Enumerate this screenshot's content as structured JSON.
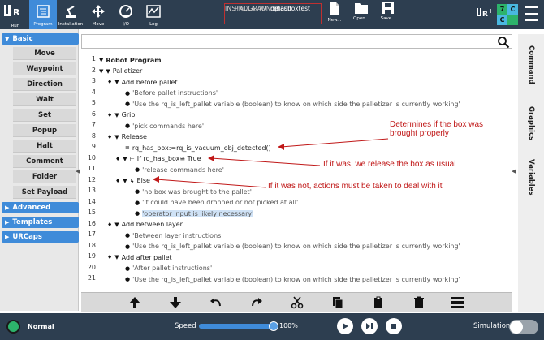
{
  "topbar": {
    "nav": [
      {
        "label": "Run"
      },
      {
        "label": "Program"
      },
      {
        "label": "Installation"
      },
      {
        "label": "Move"
      },
      {
        "label": "I/O"
      },
      {
        "label": "Log"
      }
    ],
    "program_key": "PROGRAM",
    "program_value": "rqhasboxtest",
    "installation_key": "INSTALLATION",
    "installation_value": "default",
    "file_buttons": [
      {
        "label": "New..."
      },
      {
        "label": "Open..."
      },
      {
        "label": "Save..."
      }
    ],
    "badges": [
      "7",
      "C",
      "C",
      ""
    ]
  },
  "sidebar": {
    "basic": "Basic",
    "items": [
      "Move",
      "Waypoint",
      "Direction",
      "Wait",
      "Set",
      "Popup",
      "Halt",
      "Comment",
      "Folder",
      "Set Payload"
    ],
    "advanced": "Advanced",
    "templates": "Templates",
    "urcaps": "URCaps"
  },
  "program": {
    "lines": [
      {
        "n": "1",
        "text": "Robot Program"
      },
      {
        "n": "2",
        "text": "Palletizer"
      },
      {
        "n": "3",
        "text": "Add before pallet"
      },
      {
        "n": "4",
        "text": "'Before pallet instructions'"
      },
      {
        "n": "5",
        "text": "'Use the rq_is_left_pallet variable (boolean) to know on which side the palletizer is currently working'"
      },
      {
        "n": "6",
        "text": "Grip"
      },
      {
        "n": "7",
        "text": "'pick commands here'"
      },
      {
        "n": "8",
        "text": "Release"
      },
      {
        "n": "9",
        "text": "rq_has_box:=rq_is_vacuum_obj_detected()"
      },
      {
        "n": "10",
        "text": "If rq_has_box≅ True"
      },
      {
        "n": "11",
        "text": "'release commands here'"
      },
      {
        "n": "12",
        "text": "Else"
      },
      {
        "n": "13",
        "text": "'no box was brought to the pallet'"
      },
      {
        "n": "14",
        "text": "'It could have been dropped or not picked at all'"
      },
      {
        "n": "15",
        "text": "'operator input is likely necessary'"
      },
      {
        "n": "16",
        "text": "Add between layer"
      },
      {
        "n": "17",
        "text": "'Between layer instructions'"
      },
      {
        "n": "18",
        "text": "'Use the rq_is_left_pallet variable (boolean) to know on which side the palletizer is currently working'"
      },
      {
        "n": "19",
        "text": "Add after pallet"
      },
      {
        "n": "20",
        "text": "'After pallet instructions'"
      },
      {
        "n": "21",
        "text": "'Use the rq_is_left_pallet variable (boolean) to know on which side the palletizer is currently working'"
      }
    ]
  },
  "annotations": {
    "a1_line1": "Determines if the box was",
    "a1_line2": "brought properly",
    "a2": "If it was, we release the box as usual",
    "a3": "If it was not, actions must be taken to deal with it"
  },
  "right_tabs": [
    "Command",
    "Graphics",
    "Variables"
  ],
  "bottombar": {
    "status": "Normal",
    "speed_label": "Speed",
    "speed_value": "100%",
    "speed_fraction": 1.0,
    "simulation_label": "Simulation"
  },
  "colors": {
    "topbar": "#2d3e50",
    "accent": "#3f8bd9",
    "annotation": "#c01818",
    "status_ok": "#2db36b"
  }
}
